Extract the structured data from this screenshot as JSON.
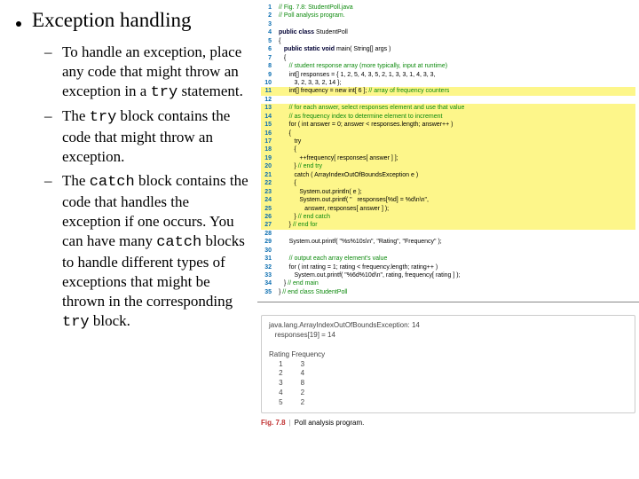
{
  "title": "Exception handling",
  "bullets": [
    {
      "pre": "To handle an exception, place any code that might throw an exception in a ",
      "code": "try",
      "post": " statement."
    },
    {
      "pre": "The ",
      "code": "try",
      "post": " block contains the code that might throw an exception."
    },
    {
      "pre": "The ",
      "code": "catch",
      "post": " block contains the code that handles the exception if one occurs. You can have many ",
      "code2": "catch",
      "post2": " blocks to handle different types of exceptions that might be thrown in the corresponding ",
      "code3": "try",
      "post3": " block."
    }
  ],
  "code": {
    "lines": [
      {
        "n": 1,
        "hl": false,
        "seg": [
          {
            "t": "// Fig. 7.8: StudentPoll.java",
            "c": "cm"
          }
        ]
      },
      {
        "n": 2,
        "hl": false,
        "seg": [
          {
            "t": "// Poll analysis program.",
            "c": "cm"
          }
        ]
      },
      {
        "n": 3,
        "hl": false,
        "seg": [
          {
            "t": " ",
            "c": ""
          }
        ]
      },
      {
        "n": 4,
        "hl": false,
        "seg": [
          {
            "t": "public class ",
            "c": "kw"
          },
          {
            "t": "StudentPoll",
            "c": ""
          }
        ]
      },
      {
        "n": 5,
        "hl": false,
        "seg": [
          {
            "t": "{",
            "c": ""
          }
        ]
      },
      {
        "n": 6,
        "hl": false,
        "seg": [
          {
            "t": "   public static void ",
            "c": "kw"
          },
          {
            "t": "main( String[] args )",
            "c": ""
          }
        ]
      },
      {
        "n": 7,
        "hl": false,
        "seg": [
          {
            "t": "   {",
            "c": ""
          }
        ]
      },
      {
        "n": 8,
        "hl": false,
        "seg": [
          {
            "t": "      // student response array (more typically, input at runtime)",
            "c": "cm"
          }
        ]
      },
      {
        "n": 9,
        "hl": false,
        "seg": [
          {
            "t": "      int[] responses = { 1, 2, 5, 4, 3, 5, 2, 1, 3, 3, 1, 4, 3, 3,",
            "c": ""
          }
        ]
      },
      {
        "n": 10,
        "hl": false,
        "seg": [
          {
            "t": "         3, 2, 3, 3, 2, 14 };",
            "c": ""
          }
        ]
      },
      {
        "n": 11,
        "hl": true,
        "seg": [
          {
            "t": "      int[] frequency = new int[ 6 ]; ",
            "c": ""
          },
          {
            "t": "// array of frequency counters",
            "c": "cm"
          }
        ]
      },
      {
        "n": 12,
        "hl": false,
        "seg": [
          {
            "t": " ",
            "c": ""
          }
        ]
      },
      {
        "n": 13,
        "hl": true,
        "seg": [
          {
            "t": "      // for each answer, select responses element and use that value",
            "c": "cm"
          }
        ]
      },
      {
        "n": 14,
        "hl": true,
        "seg": [
          {
            "t": "      // as frequency index to determine element to increment",
            "c": "cm"
          }
        ]
      },
      {
        "n": 15,
        "hl": true,
        "seg": [
          {
            "t": "      for ( int answer = 0; answer < responses.length; answer++ )",
            "c": ""
          }
        ]
      },
      {
        "n": 16,
        "hl": true,
        "seg": [
          {
            "t": "      {",
            "c": ""
          }
        ]
      },
      {
        "n": 17,
        "hl": true,
        "seg": [
          {
            "t": "         try",
            "c": ""
          }
        ]
      },
      {
        "n": 18,
        "hl": true,
        "seg": [
          {
            "t": "         {",
            "c": ""
          }
        ]
      },
      {
        "n": 19,
        "hl": true,
        "seg": [
          {
            "t": "            ++frequency[ responses[ answer ] ];",
            "c": ""
          }
        ]
      },
      {
        "n": 20,
        "hl": true,
        "seg": [
          {
            "t": "         } ",
            "c": ""
          },
          {
            "t": "// end try",
            "c": "cm"
          }
        ]
      },
      {
        "n": 21,
        "hl": true,
        "seg": [
          {
            "t": "         catch ( ArrayIndexOutOfBoundsException e )",
            "c": ""
          }
        ]
      },
      {
        "n": 22,
        "hl": true,
        "seg": [
          {
            "t": "         {",
            "c": ""
          }
        ]
      },
      {
        "n": 23,
        "hl": true,
        "seg": [
          {
            "t": "            System.out.println( e );",
            "c": ""
          }
        ]
      },
      {
        "n": 24,
        "hl": true,
        "seg": [
          {
            "t": "            System.out.printf( \"   responses[%d] = %d\\n\\n\",",
            "c": ""
          }
        ]
      },
      {
        "n": 25,
        "hl": true,
        "seg": [
          {
            "t": "               answer, responses[ answer ] );",
            "c": ""
          }
        ]
      },
      {
        "n": 26,
        "hl": true,
        "seg": [
          {
            "t": "         } ",
            "c": ""
          },
          {
            "t": "// end catch",
            "c": "cm"
          }
        ]
      },
      {
        "n": 27,
        "hl": true,
        "seg": [
          {
            "t": "      } ",
            "c": ""
          },
          {
            "t": "// end for",
            "c": "cm"
          }
        ]
      },
      {
        "n": 28,
        "hl": false,
        "seg": [
          {
            "t": " ",
            "c": ""
          }
        ]
      },
      {
        "n": 29,
        "hl": false,
        "seg": [
          {
            "t": "      System.out.printf( \"%s%10s\\n\", \"Rating\", \"Frequency\" );",
            "c": ""
          }
        ]
      },
      {
        "n": 30,
        "hl": false,
        "seg": [
          {
            "t": " ",
            "c": ""
          }
        ]
      },
      {
        "n": 31,
        "hl": false,
        "seg": [
          {
            "t": "      // output each array element's value",
            "c": "cm"
          }
        ]
      },
      {
        "n": 32,
        "hl": false,
        "seg": [
          {
            "t": "      for ( int rating = 1; rating < frequency.length; rating++ )",
            "c": ""
          }
        ]
      },
      {
        "n": 33,
        "hl": false,
        "seg": [
          {
            "t": "         System.out.printf( \"%6d%10d\\n\", rating, frequency[ rating ] );",
            "c": ""
          }
        ]
      },
      {
        "n": 34,
        "hl": false,
        "seg": [
          {
            "t": "   } ",
            "c": ""
          },
          {
            "t": "// end main",
            "c": "cm"
          }
        ]
      },
      {
        "n": 35,
        "hl": false,
        "seg": [
          {
            "t": "} ",
            "c": ""
          },
          {
            "t": "// end class StudentPoll",
            "c": "cm"
          }
        ]
      }
    ]
  },
  "output": "java.lang.ArrayIndexOutOfBoundsException: 14\n   responses[19] = 14\n\nRating Frequency\n     1         3\n     2         4\n     3         8\n     4         2\n     5         2",
  "figure": {
    "num": "Fig. 7.8",
    "caption": "Poll analysis program."
  }
}
